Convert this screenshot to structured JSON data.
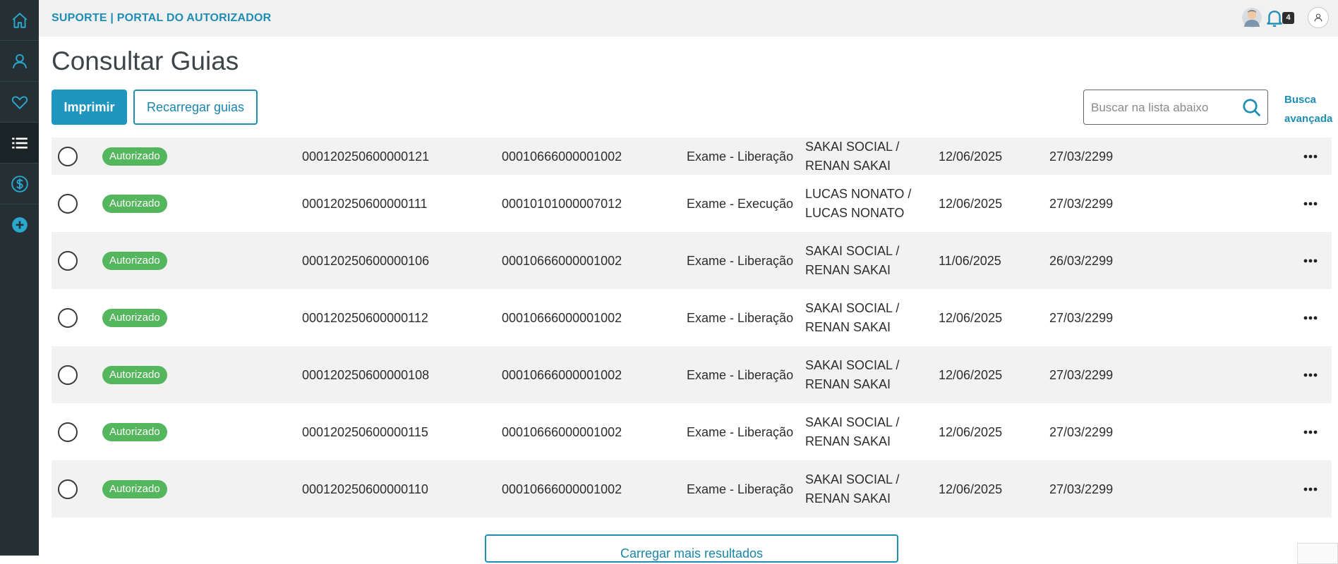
{
  "header": {
    "portal_title": "SUPORTE | PORTAL DO AUTORIZADOR",
    "notification_count": "4"
  },
  "page": {
    "title": "Consultar Guias"
  },
  "toolbar": {
    "print_label": "Imprimir",
    "reload_label": "Recarregar guias",
    "search_placeholder": "Buscar na lista abaixo",
    "advanced_search_line1": "Busca",
    "advanced_search_line2": "avançada"
  },
  "colors": {
    "sidebar_bg": "#243033",
    "accent": "#1e96bf",
    "status_green": "#55b75d"
  },
  "icons": {
    "sidebar": [
      "home-icon",
      "user-icon",
      "heart-icon",
      "list-icon",
      "dollar-icon",
      "add-icon"
    ],
    "header": [
      "avatar-icon",
      "bell-icon",
      "user-icon"
    ],
    "row_action": "more-options-icon",
    "search": "search-icon"
  },
  "rows": [
    {
      "status": "Autorizado",
      "guide": "000120250600000121",
      "code": "00010666000001002",
      "type": "Exame - Liberação",
      "name1": "SAKAI SOCIAL /",
      "name2": "RENAN SAKAI",
      "date1": "12/06/2025",
      "date2": "27/03/2299"
    },
    {
      "status": "Autorizado",
      "guide": "000120250600000111",
      "code": "00010101000007012",
      "type": "Exame - Execução",
      "name1": "LUCAS NONATO /",
      "name2": "LUCAS NONATO",
      "date1": "12/06/2025",
      "date2": "27/03/2299"
    },
    {
      "status": "Autorizado",
      "guide": "000120250600000106",
      "code": "00010666000001002",
      "type": "Exame - Liberação",
      "name1": "SAKAI SOCIAL /",
      "name2": "RENAN SAKAI",
      "date1": "11/06/2025",
      "date2": "26/03/2299"
    },
    {
      "status": "Autorizado",
      "guide": "000120250600000112",
      "code": "00010666000001002",
      "type": "Exame - Liberação",
      "name1": "SAKAI SOCIAL /",
      "name2": "RENAN SAKAI",
      "date1": "12/06/2025",
      "date2": "27/03/2299"
    },
    {
      "status": "Autorizado",
      "guide": "000120250600000108",
      "code": "00010666000001002",
      "type": "Exame - Liberação",
      "name1": "SAKAI SOCIAL /",
      "name2": "RENAN SAKAI",
      "date1": "12/06/2025",
      "date2": "27/03/2299"
    },
    {
      "status": "Autorizado",
      "guide": "000120250600000115",
      "code": "00010666000001002",
      "type": "Exame - Liberação",
      "name1": "SAKAI SOCIAL /",
      "name2": "RENAN SAKAI",
      "date1": "12/06/2025",
      "date2": "27/03/2299"
    },
    {
      "status": "Autorizado",
      "guide": "000120250600000110",
      "code": "00010666000001002",
      "type": "Exame - Liberação",
      "name1": "SAKAI SOCIAL /",
      "name2": "RENAN SAKAI",
      "date1": "12/06/2025",
      "date2": "27/03/2299"
    }
  ],
  "footer": {
    "load_more_label": "Carregar mais resultados"
  }
}
